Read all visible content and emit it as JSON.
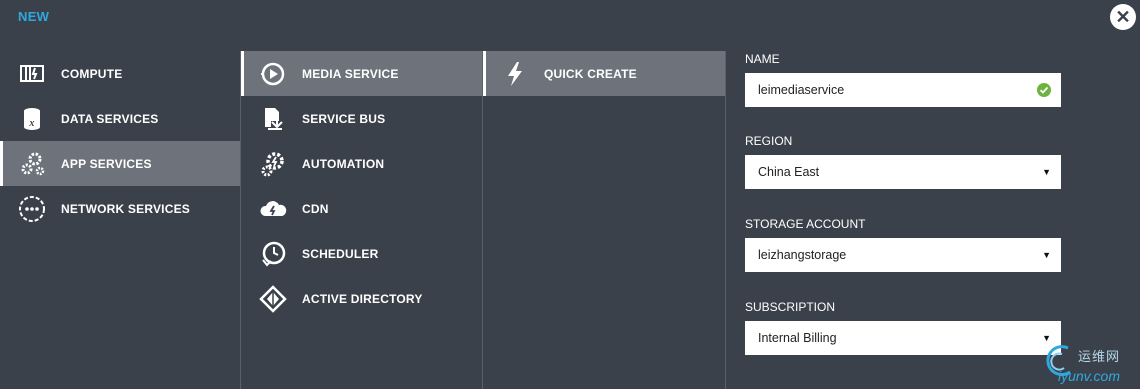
{
  "header": {
    "title": "NEW"
  },
  "close_icon_label": "✕",
  "categories": [
    {
      "label": "COMPUTE",
      "icon": "compute-icon",
      "selected": false
    },
    {
      "label": "DATA SERVICES",
      "icon": "data-services-icon",
      "selected": false
    },
    {
      "label": "APP SERVICES",
      "icon": "app-services-icon",
      "selected": true
    },
    {
      "label": "NETWORK SERVICES",
      "icon": "network-services-icon",
      "selected": false
    }
  ],
  "services": [
    {
      "label": "MEDIA SERVICE",
      "icon": "media-service-icon",
      "selected": true
    },
    {
      "label": "SERVICE BUS",
      "icon": "service-bus-icon",
      "selected": false
    },
    {
      "label": "AUTOMATION",
      "icon": "automation-icon",
      "selected": false
    },
    {
      "label": "CDN",
      "icon": "cdn-icon",
      "selected": false
    },
    {
      "label": "SCHEDULER",
      "icon": "scheduler-icon",
      "selected": false
    },
    {
      "label": "ACTIVE DIRECTORY",
      "icon": "active-directory-icon",
      "selected": false
    }
  ],
  "actions": [
    {
      "label": "QUICK CREATE",
      "icon": "lightning-icon",
      "selected": true
    }
  ],
  "form": {
    "name": {
      "label": "NAME",
      "value": "leimediaservice",
      "valid": true
    },
    "region": {
      "label": "REGION",
      "value": "China East"
    },
    "storage": {
      "label": "STORAGE ACCOUNT",
      "value": "leizhangstorage"
    },
    "subscription": {
      "label": "SUBSCRIPTION",
      "value": "Internal Billing"
    }
  },
  "watermark": {
    "cn": "运维网",
    "en": "iyunv.com"
  },
  "colors": {
    "background": "#3b414b",
    "selected": "#6e737b",
    "accent": "#2fa8e0",
    "valid": "#6cb33f"
  }
}
